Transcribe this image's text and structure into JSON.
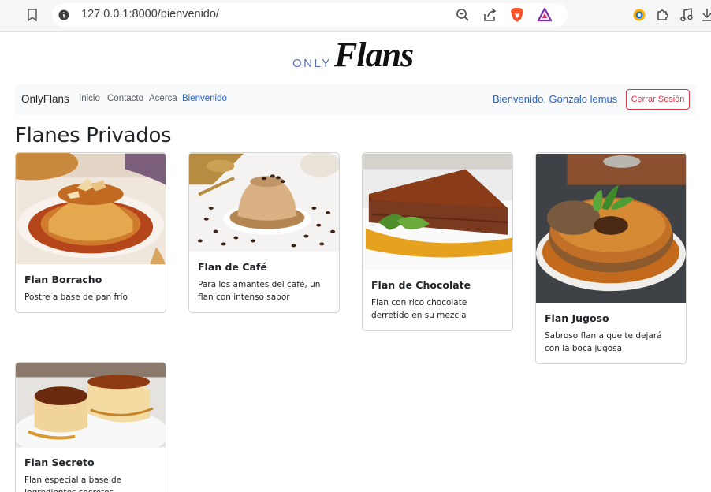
{
  "browser": {
    "url": "127.0.0.1:8000/bienvenido/"
  },
  "logo": {
    "only": "ONLY",
    "flans": "Flans"
  },
  "navbar": {
    "brand": "OnlyFlans",
    "links": [
      {
        "label": "Inicio"
      },
      {
        "label": "Contacto"
      },
      {
        "label": "Acerca"
      },
      {
        "label": "Bienvenido"
      }
    ],
    "welcome_text": "Bienvenido, Gonzalo lemus",
    "logout_label": "Cerrar Sesión"
  },
  "page": {
    "title": "Flanes Privados"
  },
  "cards": [
    {
      "title": "Flan Borracho",
      "text": "Postre a base de pan frío"
    },
    {
      "title": "Flan de Café",
      "text": "Para los amantes del café, un flan con intenso sabor"
    },
    {
      "title": "Flan de Chocolate",
      "text": "Flan con rico chocolate derretido en su mezcla"
    },
    {
      "title": "Flan Jugoso",
      "text": "Sabroso flan a que te dejará con la boca jugosa"
    },
    {
      "title": "Flan Secreto",
      "text": "Flan especial a base de ingredientes secretos"
    }
  ],
  "colors": {
    "link_active": "#2a63c8",
    "danger": "#dc3545",
    "navbar_bg": "#f8f9fa"
  }
}
